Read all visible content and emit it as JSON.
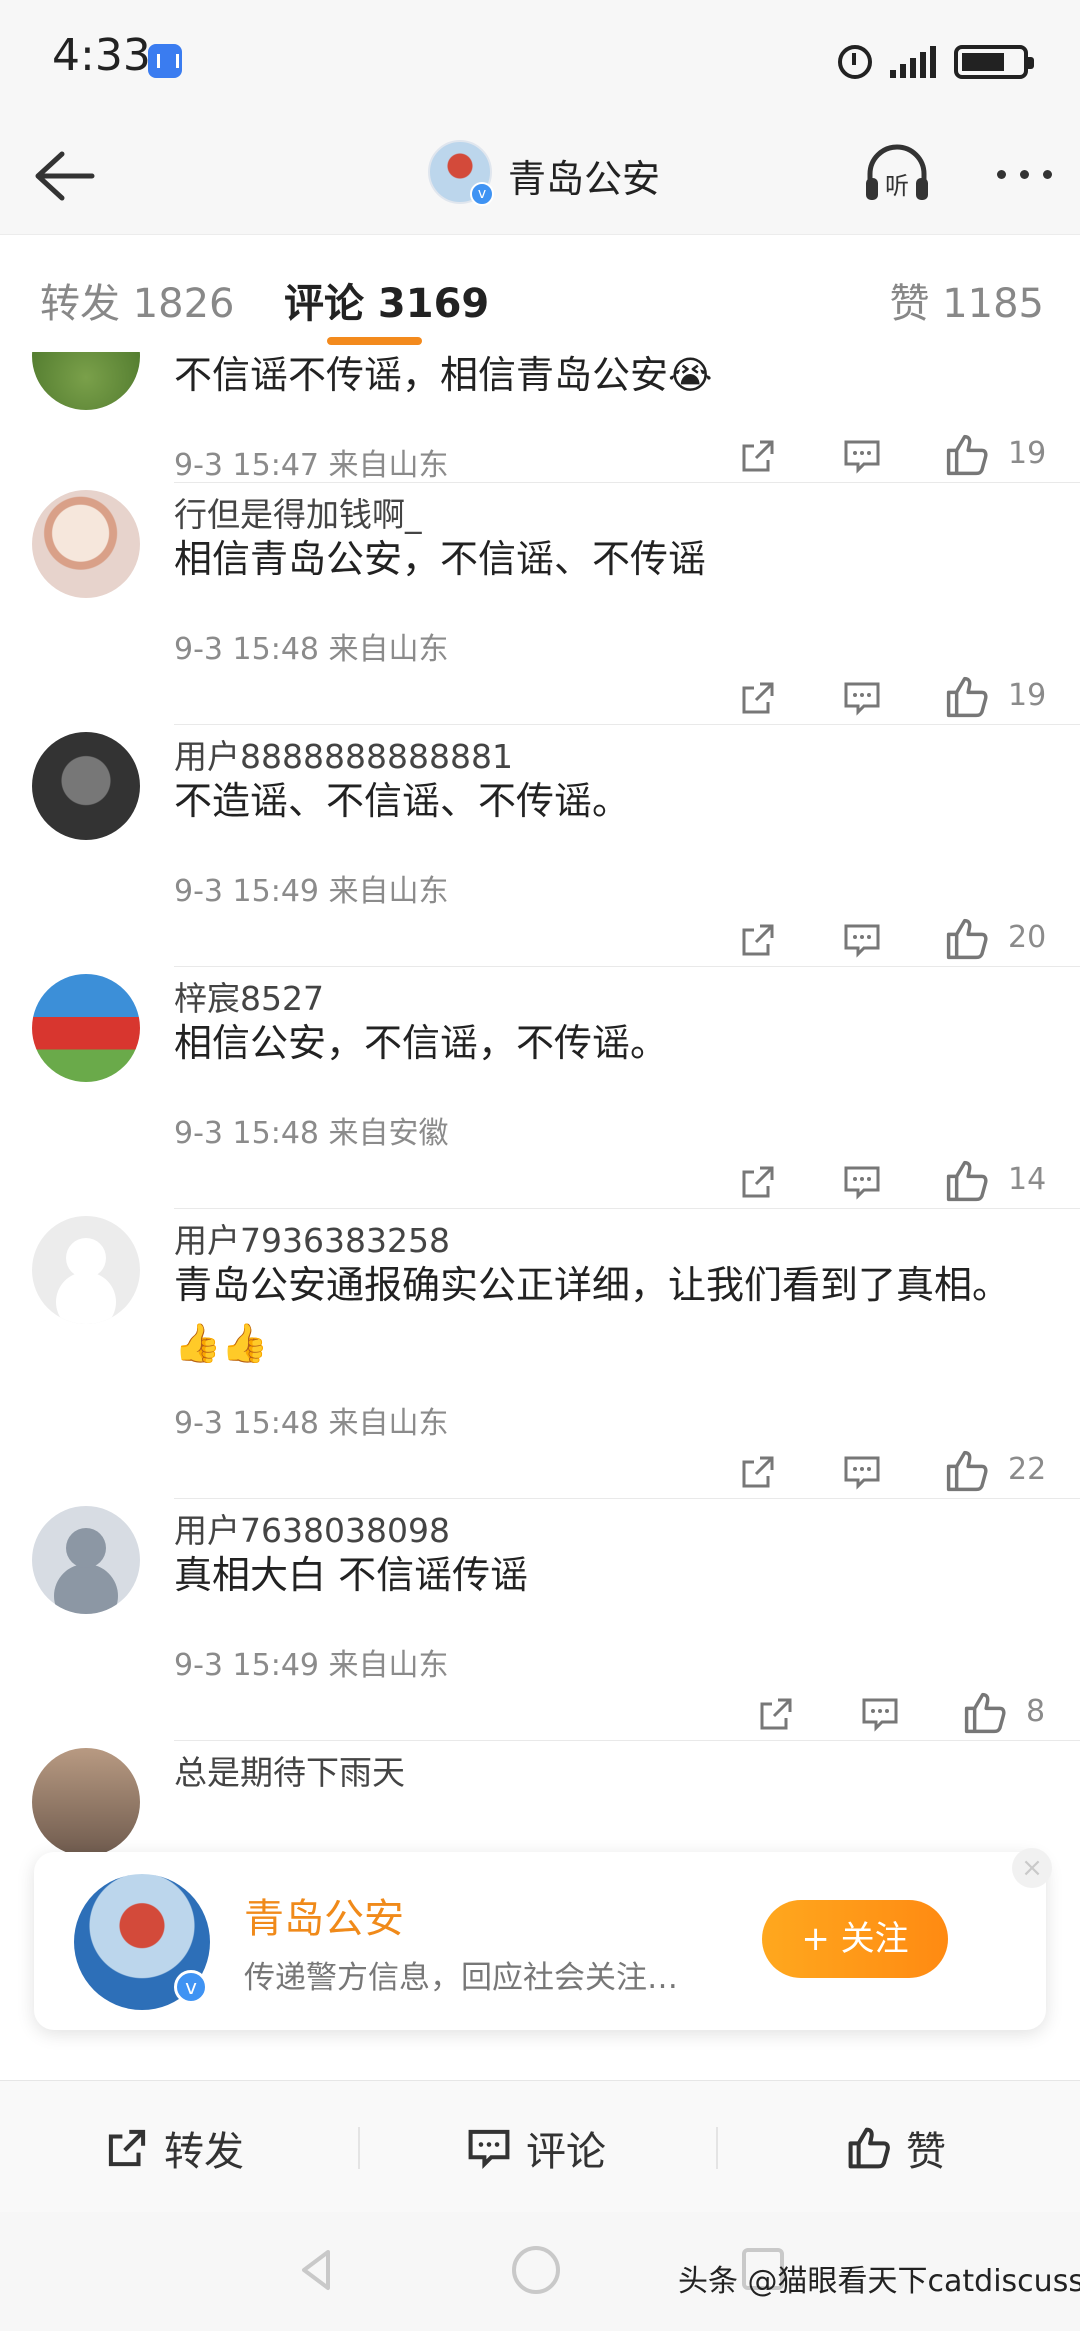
{
  "status_bar": {
    "time": "4:33"
  },
  "header": {
    "title": "青岛公安",
    "verified_mark": "v"
  },
  "tabs": [
    {
      "label": "转发 1826",
      "active": false
    },
    {
      "label": "评论 3169",
      "active": true
    },
    {
      "label": "赞 1185",
      "active": false
    }
  ],
  "comments": [
    {
      "username": "",
      "text": "不信谣不传谣，相信青岛公安😭",
      "time": "9-3 15:47",
      "source": "来自山东",
      "likes": "19"
    },
    {
      "username": "行但是得加钱啊_",
      "text": "相信青岛公安，不信谣、不传谣",
      "time": "9-3 15:48",
      "source": "来自山东",
      "likes": "19"
    },
    {
      "username": "用户8888888888881",
      "text": "不造谣、不信谣、不传谣。",
      "time": "9-3 15:49",
      "source": "来自山东",
      "likes": "20"
    },
    {
      "username": "梓宸8527",
      "text": "相信公安，不信谣，不传谣。",
      "time": "9-3 15:48",
      "source": "来自安徽",
      "likes": "14"
    },
    {
      "username": "用户7936383258",
      "text": "青岛公安通报确实公正详细，让我们看到了真相。👍👍",
      "time": "9-3 15:48",
      "source": "来自山东",
      "likes": "22"
    },
    {
      "username": "用户7638038098",
      "text": "真相大白 不信谣传谣",
      "time": "9-3 15:49",
      "source": "来自山东",
      "likes": "8"
    },
    {
      "username": "总是期待下雨天",
      "text": "",
      "time": "",
      "source": "",
      "likes": ""
    }
  ],
  "popup": {
    "name": "青岛公安",
    "description": "传递警方信息，回应社会关注…",
    "follow_label": "+ 关注",
    "close_label": "×"
  },
  "bottom_bar": {
    "repost": "转发",
    "comment": "评论",
    "like": "赞"
  },
  "watermark": "头条 @猫眼看天下catdiscuss",
  "colors": {
    "accent": "#f38a1d",
    "follow_button": "#ff9a17",
    "verified": "#3f93f3"
  }
}
